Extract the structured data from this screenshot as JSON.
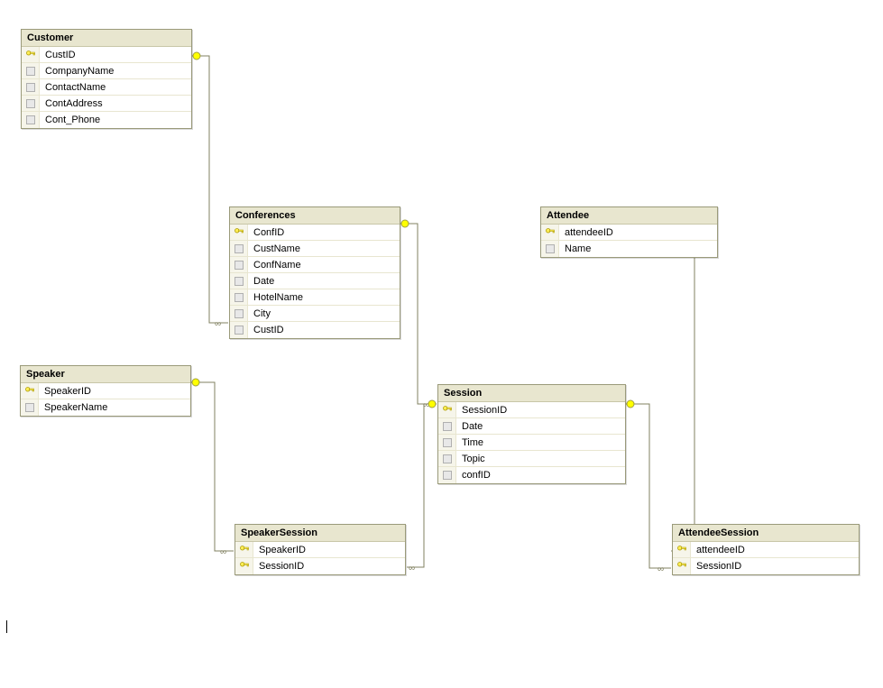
{
  "tables": {
    "customer": {
      "title": "Customer",
      "columns": [
        {
          "name": "CustID",
          "pk": true
        },
        {
          "name": "CompanyName",
          "pk": false
        },
        {
          "name": "ContactName",
          "pk": false
        },
        {
          "name": "ContAddress",
          "pk": false
        },
        {
          "name": "Cont_Phone",
          "pk": false
        }
      ]
    },
    "conferences": {
      "title": "Conferences",
      "columns": [
        {
          "name": "ConfID",
          "pk": true
        },
        {
          "name": "CustName",
          "pk": false
        },
        {
          "name": "ConfName",
          "pk": false
        },
        {
          "name": "Date",
          "pk": false
        },
        {
          "name": "HotelName",
          "pk": false
        },
        {
          "name": "City",
          "pk": false
        },
        {
          "name": "CustID",
          "pk": false
        }
      ]
    },
    "speaker": {
      "title": "Speaker",
      "columns": [
        {
          "name": "SpeakerID",
          "pk": true
        },
        {
          "name": "SpeakerName",
          "pk": false
        }
      ]
    },
    "session": {
      "title": "Session",
      "columns": [
        {
          "name": "SessionID",
          "pk": true
        },
        {
          "name": "Date",
          "pk": false
        },
        {
          "name": "Time",
          "pk": false
        },
        {
          "name": "Topic",
          "pk": false
        },
        {
          "name": "confID",
          "pk": false
        }
      ]
    },
    "attendee": {
      "title": "Attendee",
      "columns": [
        {
          "name": "attendeeID",
          "pk": true
        },
        {
          "name": "Name",
          "pk": false
        }
      ]
    },
    "speakersession": {
      "title": "SpeakerSession",
      "columns": [
        {
          "name": "SpeakerID",
          "pk": true
        },
        {
          "name": "SessionID",
          "pk": true
        }
      ]
    },
    "attendeesession": {
      "title": "AttendeeSession",
      "columns": [
        {
          "name": "attendeeID",
          "pk": true
        },
        {
          "name": "SessionID",
          "pk": true
        }
      ]
    }
  },
  "relationships": [
    {
      "from": "Customer.CustID",
      "to": "Conferences.CustID",
      "type": "one-to-many"
    },
    {
      "from": "Conferences.ConfID",
      "to": "Session.confID",
      "type": "one-to-many"
    },
    {
      "from": "Speaker.SpeakerID",
      "to": "SpeakerSession.SpeakerID",
      "type": "one-to-many"
    },
    {
      "from": "Session.SessionID",
      "to": "SpeakerSession.SessionID",
      "type": "one-to-many"
    },
    {
      "from": "Session.SessionID",
      "to": "AttendeeSession.SessionID",
      "type": "one-to-many"
    },
    {
      "from": "Attendee.attendeeID",
      "to": "AttendeeSession.attendeeID",
      "type": "one-to-many"
    }
  ]
}
